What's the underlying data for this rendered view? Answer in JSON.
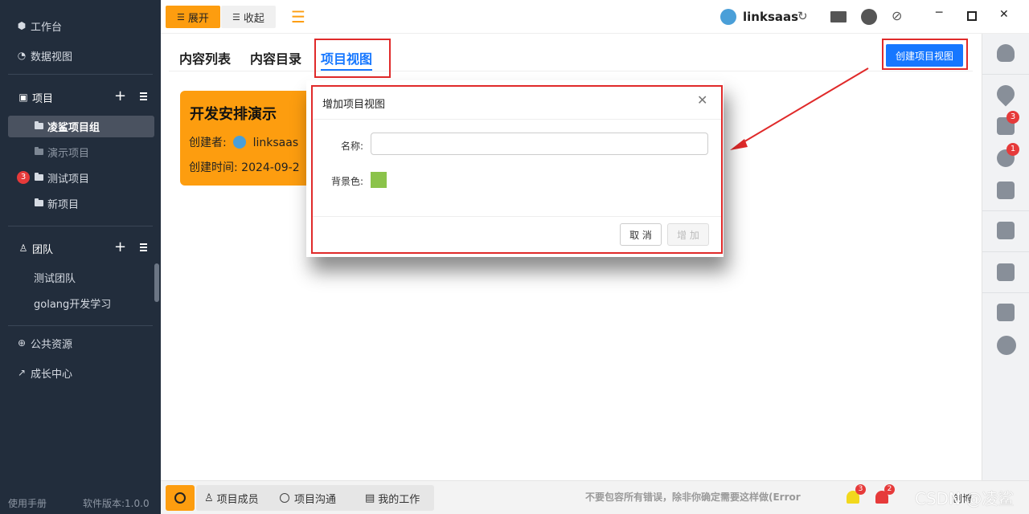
{
  "sidebar": {
    "workbench": "工作台",
    "data_view": "数据视图",
    "project_header": "项目",
    "projects": [
      {
        "label": "凌鲨项目组",
        "selected": true
      },
      {
        "label": "演示项目"
      },
      {
        "label": "测试项目",
        "badge": "3"
      },
      {
        "label": "新项目"
      }
    ],
    "team_header": "团队",
    "teams": [
      "测试团队",
      "golang开发学习"
    ],
    "public_resources": "公共资源",
    "growth_center": "成长中心",
    "manual": "使用手册",
    "version": "软件版本:1.0.0"
  },
  "topbar": {
    "expand": "展开",
    "collapse": "收起",
    "user": "linksaas"
  },
  "tabs": [
    "内容列表",
    "内容目录",
    "项目视图"
  ],
  "create_view_button": "创建项目视图",
  "card": {
    "title": "开发安排演示",
    "creator_label": "创建者:",
    "creator": "linksaas",
    "created_label": "创建时间:",
    "created_value": "2024-09-2"
  },
  "dialog": {
    "title": "增加项目视图",
    "name_label": "名称:",
    "name_value": "",
    "bg_label": "背景色:",
    "bg_color": "#8bc34a",
    "cancel": "取 消",
    "add": "增 加"
  },
  "rightbar_badges": {
    "doc": "3",
    "bug": "1"
  },
  "bottombar": {
    "members": "项目成员",
    "chat": "项目沟通",
    "my_work": "我的工作",
    "notice": "不要包容所有错误，除非你确定需要这样做(Error",
    "alarm1": "3",
    "alarm2": "2",
    "watermark": "CSDN @凌鲨",
    "extra": "创博"
  },
  "colors": {
    "accent": "#1677ff",
    "orange": "#fd9d0f",
    "sidebar": "#222d3c",
    "highlight": "#e02a2a"
  }
}
